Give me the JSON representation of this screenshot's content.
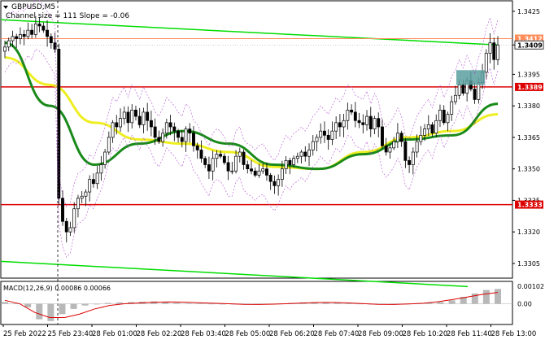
{
  "chart_data": {
    "type": "candlestick",
    "symbol_label": "GBPUSD,M5",
    "indicator_label": "Channel size = 111 Slope = -0.06",
    "macd_label": "MACD(12,26,9) 0.00086 0.00066",
    "ylim": [
      1.3298,
      1.343
    ],
    "price_ticks": [
      "1.3425",
      "1.3409",
      "1.3395",
      "1.3380",
      "1.3365",
      "1.3350",
      "1.3335",
      "1.3320",
      "1.3305"
    ],
    "x_labels": [
      "25 Feb 2022",
      "25 Feb 23:40",
      "28 Feb 01:00",
      "28 Feb 02:20",
      "28 Feb 03:40",
      "28 Feb 05:00",
      "28 Feb 06:20",
      "28 Feb 07:40",
      "28 Feb 09:00",
      "28 Feb 10:20",
      "28 Feb 11:40",
      "28 Feb 13:00"
    ],
    "macd_ticks": [
      "0.00102",
      "0.00"
    ],
    "macd_ylim": [
      -0.0012,
      0.0013
    ],
    "current_price": "1.3409",
    "levels": [
      {
        "value": 1.3389,
        "label": "1.3389",
        "color": "#dd0000"
      },
      {
        "value": 1.3333,
        "label": "1.3333",
        "color": "#dd0000"
      },
      {
        "value": 1.3412,
        "label": "1.3412",
        "color": "#ff8c5a"
      }
    ],
    "closes": [
      1.3408,
      1.3411,
      1.3413,
      1.3412,
      1.3414,
      1.3413,
      1.3416,
      1.3414,
      1.3419,
      1.3418,
      1.3416,
      1.3413,
      1.341,
      1.3407,
      1.3336,
      1.3325,
      1.332,
      1.3322,
      1.3331,
      1.3336,
      1.3337,
      1.3339,
      1.3345,
      1.3343,
      1.3348,
      1.3352,
      1.3358,
      1.3365,
      1.3372,
      1.337,
      1.3374,
      1.3377,
      1.3372,
      1.3378,
      1.3375,
      1.3371,
      1.3377,
      1.3373,
      1.337,
      1.3365,
      1.3363,
      1.3367,
      1.3372,
      1.337,
      1.3368,
      1.3365,
      1.3363,
      1.3369,
      1.3367,
      1.3361,
      1.3359,
      1.3355,
      1.3352,
      1.3349,
      1.3355,
      1.3357,
      1.3356,
      1.3353,
      1.3349,
      1.3349,
      1.3356,
      1.3358,
      1.3352,
      1.335,
      1.3349,
      1.3347,
      1.3349,
      1.335,
      1.3347,
      1.3344,
      1.3342,
      1.3345,
      1.335,
      1.3354,
      1.3352,
      1.3355,
      1.3356,
      1.3358,
      1.3356,
      1.3359,
      1.3363,
      1.3365,
      1.3368,
      1.3366,
      1.3364,
      1.3368,
      1.3372,
      1.337,
      1.3373,
      1.3378,
      1.3377,
      1.3373,
      1.3372,
      1.3371,
      1.3375,
      1.3369,
      1.3374,
      1.337,
      1.3361,
      1.3358,
      1.336,
      1.3363,
      1.3367,
      1.3363,
      1.3354,
      1.3352,
      1.3358,
      1.3363,
      1.3366,
      1.3369,
      1.3371,
      1.3367,
      1.3373,
      1.3378,
      1.3372,
      1.3376,
      1.3382,
      1.3385,
      1.339,
      1.3386,
      1.3392,
      1.3388,
      1.3383,
      1.3391,
      1.3396,
      1.3405,
      1.341,
      1.3402,
      1.3409
    ],
    "channel_upper": [
      1.3421,
      1.3409
    ],
    "channel_lower": [
      1.3306,
      1.3294
    ],
    "ma_green": [
      1.341,
      1.338,
      1.3352,
      1.3362,
      1.3368,
      1.3362,
      1.3352,
      1.335,
      1.3357,
      1.3364,
      1.3366,
      1.3381
    ],
    "ma_yellow": [
      1.3403,
      1.339,
      1.3372,
      1.3364,
      1.3362,
      1.3358,
      1.3351,
      1.335,
      1.3358,
      1.3365,
      1.3368,
      1.3376
    ],
    "macd_hist": [
      0.0001,
      3e-05,
      -0.0002,
      -0.0009,
      -0.001,
      -0.0006,
      -0.0003,
      -0.0001,
      0.0,
      5e-05,
      8e-05,
      0.0001,
      0.00012,
      0.00014,
      0.0001,
      6e-05,
      3e-05,
      2e-05,
      1e-05,
      -1e-05,
      -3e-05,
      -5e-05,
      -4e-05,
      -2e-05,
      2e-05,
      5e-05,
      8e-05,
      0.0001,
      9e-05,
      6e-05,
      3e-05,
      1e-05,
      -2e-05,
      -4e-05,
      -5e-05,
      -3e-05,
      2e-05,
      6e-05,
      0.0001,
      0.0002,
      0.0004,
      0.0006,
      0.0008,
      0.00086
    ],
    "macd_signal": [
      0.0002,
      0.0,
      -0.0005,
      -0.0008,
      -0.0008,
      -0.0006,
      -0.0003,
      -0.0001,
      0.0,
      5e-05,
      9e-05,
      0.00011,
      0.0001,
      6e-05,
      3e-05,
      0.0,
      -3e-05,
      -4e-05,
      -2e-05,
      1e-05,
      5e-05,
      8e-05,
      8e-05,
      5e-05,
      1e-05,
      -3e-05,
      -4e-05,
      -1e-05,
      3e-05,
      0.00012,
      0.00025,
      0.0004,
      0.00055,
      0.00066
    ]
  }
}
